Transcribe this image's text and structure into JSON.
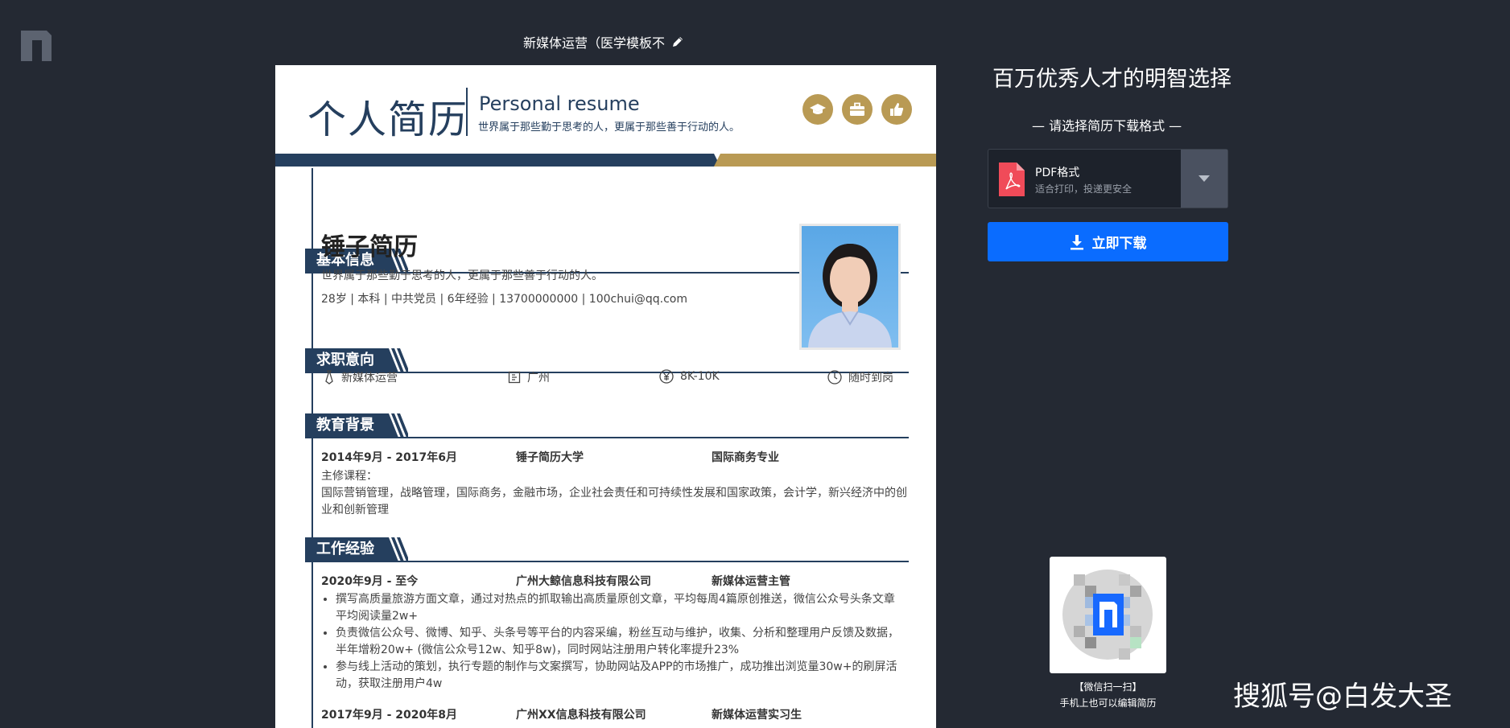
{
  "header": {
    "doc_title": "新媒体运营（医学模板不"
  },
  "resume": {
    "title_cn": "个人简历",
    "title_en": "Personal resume",
    "motto": "世界属于那些勤于思考的人，更属于那些善于行动的人。",
    "sections": {
      "basic": "基本信息",
      "intent": "求职意向",
      "edu": "教育背景",
      "work": "工作经验"
    },
    "basic": {
      "name": "锤子简历",
      "motto": "世界属于那些勤于思考的人，更属于那些善于行动的人。",
      "details": "28岁 | 本科 | 中共党员 | 6年经验 | 13700000000 | 100chui@qq.com"
    },
    "intent": {
      "position": "新媒体运营",
      "city": "广州",
      "salary": "8K-10K",
      "availability": "随时到岗"
    },
    "education": {
      "period": "2014年9月 - 2017年6月",
      "school": "锤子简历大学",
      "major": "国际商务专业",
      "courses_label": "主修课程：",
      "courses_line1": "国际营销管理，战略管理，国际商务，金融市场，企业社会责任和可持续性发展和国家政策，会计学，新兴经济中的创",
      "courses_line2": "业和创新管理"
    },
    "work": [
      {
        "period": "2020年9月 - 至今",
        "company": "广州大鲸信息科技有限公司",
        "role": "新媒体运营主管",
        "bullets": [
          [
            "撰写高质量旅游方面文章，通过对热点的抓取输出高质量原创文章，平均每周4篇原创推送，微信公众号头条文章",
            "平均阅读量2w+"
          ],
          [
            "负责微信公众号、微博、知乎、头条号等平台的内容采编，粉丝互动与维护，收集、分析和整理用户反馈及数据，",
            "半年增粉20w+ (微信公众号12w、知乎8w)，同时网站注册用户转化率提升23%"
          ],
          [
            "参与线上活动的策划，执行专题的制作与文案撰写，协助网站及APP的市场推广，成功推出浏览量30w+的刷屏活",
            "动，获取注册用户4w"
          ]
        ]
      },
      {
        "period": "2017年9月 - 2020年8月",
        "company": "广州XX信息科技有限公司",
        "role": "新媒体运营实习生"
      }
    ]
  },
  "panel": {
    "title": "百万优秀人才的明智选择",
    "subtitle": "— 请选择简历下载格式 —",
    "format_name": "PDF格式",
    "format_desc": "适合打印，投递更安全",
    "download_label": "立即下载"
  },
  "qr": {
    "caption1": "【微信扫一扫】",
    "caption2": "手机上也可以编辑简历"
  },
  "watermark": "搜狐号@白发大圣",
  "colors": {
    "background": "#242933",
    "navy": "#253f5e",
    "gold": "#b99a54",
    "download_blue": "#0a6cff"
  }
}
